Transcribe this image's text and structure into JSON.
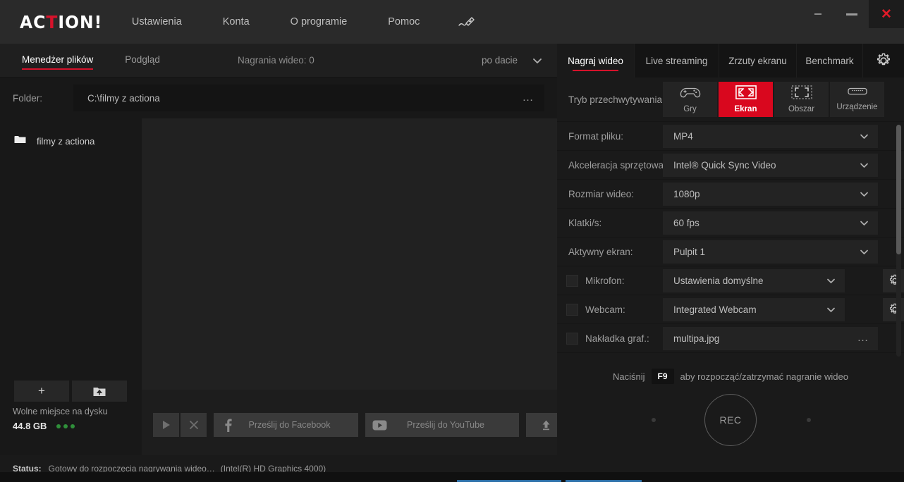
{
  "app": {
    "logo_before": "AC",
    "logo_accent": "T",
    "logo_after": "ION!",
    "accent_color": "#d6122b",
    "mode_active_color": "#d9071e"
  },
  "titlebar": {
    "menu": [
      {
        "label": "Ustawienia",
        "name": "menu-settings"
      },
      {
        "label": "Konta",
        "name": "menu-accounts"
      },
      {
        "label": "O programie",
        "name": "menu-about"
      },
      {
        "label": "Pomoc",
        "name": "menu-help"
      }
    ],
    "pen_icon": "pen-icon",
    "window_controls": {
      "mini_icon": "minimize-to-tray-icon",
      "minimize_icon": "minimize-icon",
      "close_label": "✕"
    }
  },
  "left_panel": {
    "tabs": [
      {
        "label": "Menedżer plików",
        "active": true
      },
      {
        "label": "Podgląd",
        "active": false
      }
    ],
    "recordings_count": "Nagrania wideo: 0",
    "sort": {
      "label": "po dacie",
      "caret_icon": "chevron-down-icon"
    },
    "folder": {
      "label": "Folder:",
      "path": "C:\\filmy z actiona",
      "browse_label": "…"
    },
    "tree": {
      "items": [
        {
          "label": "filmy z actiona",
          "icon": "folder-icon"
        }
      ],
      "add_button": "+",
      "open_button_icon": "folder-up-icon"
    },
    "disk": {
      "title": "Wolne miejsce na dysku",
      "value": "44.8 GB",
      "indicator_color": "#2f8f3a",
      "dots": 3
    },
    "toolbar": {
      "play_icon": "play-icon",
      "delete_icon": "close-x-icon",
      "facebook_icon": "facebook-icon",
      "facebook_label": "Prześlij do Facebook",
      "youtube_icon": "youtube-icon",
      "youtube_label": "Prześlij do YouTube",
      "upload_icon": "upload-icon"
    }
  },
  "status_bar": {
    "label": "Status:",
    "text": "Gotowy do rozpoczęcia nagrywania wideo…",
    "gpu": "(Intel(R) HD Graphics 4000)"
  },
  "right_panel": {
    "tabs": [
      {
        "label": "Nagraj wideo",
        "active": true
      },
      {
        "label": "Live streaming",
        "active": false
      },
      {
        "label": "Zrzuty ekranu",
        "active": false
      },
      {
        "label": "Benchmark",
        "active": false
      }
    ],
    "settings_gear_icon": "gear-icon",
    "capture_mode": {
      "label": "Tryb przechwytywania:",
      "options": [
        {
          "label": "Gry",
          "icon": "gamepad-icon",
          "active": false
        },
        {
          "label": "Ekran",
          "icon": "fullscreen-icon",
          "active": true
        },
        {
          "label": "Obszar",
          "icon": "region-select-icon",
          "active": false
        },
        {
          "label": "Urządzenie",
          "icon": "device-hdmi-icon",
          "active": false
        }
      ]
    },
    "settings": [
      {
        "label": "Format pliku:",
        "value": "MP4",
        "control": "select",
        "checkbox": false,
        "gear": false
      },
      {
        "label": "Akceleracja sprzętowa:",
        "value": "Intel® Quick Sync Video",
        "control": "select",
        "checkbox": false,
        "gear": false
      },
      {
        "label": "Rozmiar wideo:",
        "value": "1080p",
        "control": "select",
        "checkbox": false,
        "gear": false
      },
      {
        "label": "Klatki/s:",
        "value": "60 fps",
        "control": "select",
        "checkbox": false,
        "gear": false
      },
      {
        "label": "Aktywny ekran:",
        "value": "Pulpit 1",
        "control": "select",
        "checkbox": false,
        "gear": false
      },
      {
        "label": "Mikrofon:",
        "value": "Ustawienia domyślne",
        "control": "select",
        "checkbox": true,
        "gear": true
      },
      {
        "label": "Webcam:",
        "value": "Integrated Webcam",
        "control": "select",
        "checkbox": true,
        "gear": true
      },
      {
        "label": "Nakładka graf.:",
        "value": "multipa.jpg",
        "control": "browse",
        "checkbox": true,
        "gear": false
      }
    ],
    "record": {
      "hotkey_prefix": "Naciśnij",
      "hotkey": "F9",
      "hotkey_suffix": "aby rozpocząć/zatrzymać nagranie wideo",
      "button_label": "REC"
    }
  }
}
